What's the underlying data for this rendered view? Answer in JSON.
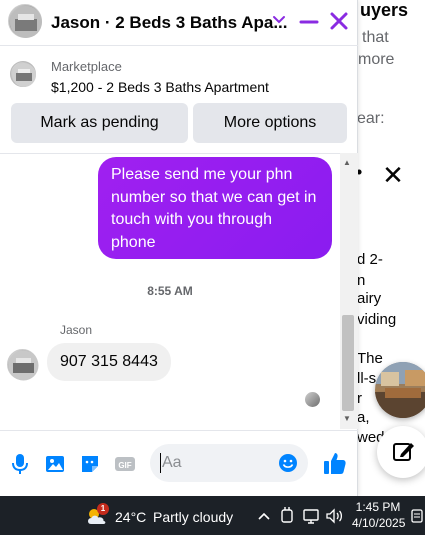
{
  "background": {
    "heading_fragment": "uyers",
    "lines": [
      "that",
      "more",
      "ear:",
      "d 2-",
      "n",
      "airy",
      "viding",
      "The",
      "ll-s",
      "r",
      "a,",
      "wed"
    ]
  },
  "chat": {
    "title": "Jason · 2 Beds 3 Baths Apa...",
    "listing": {
      "source": "Marketplace",
      "title": "$1,200 - 2 Beds 3 Baths Apartment"
    },
    "actions": {
      "pending_label": "Mark as pending",
      "more_label": "More options"
    },
    "messages": {
      "outgoing_text": "Please send me your phn number so that we can get in touch with you through phone",
      "timestamp": "8:55 AM",
      "sender_name": "Jason",
      "incoming_text": "907 315 8443"
    },
    "composer": {
      "placeholder": "Aa"
    }
  },
  "taskbar": {
    "weather_badge": "1",
    "temperature": "24°C",
    "condition": "Partly cloudy",
    "time": "1:45 PM",
    "date": "4/10/2025"
  },
  "colors": {
    "accent": "#8a2be2",
    "outgoing_bubble": "#9b1ff0",
    "icon_blue": "#0084ff",
    "taskbar": "#1c2127"
  }
}
